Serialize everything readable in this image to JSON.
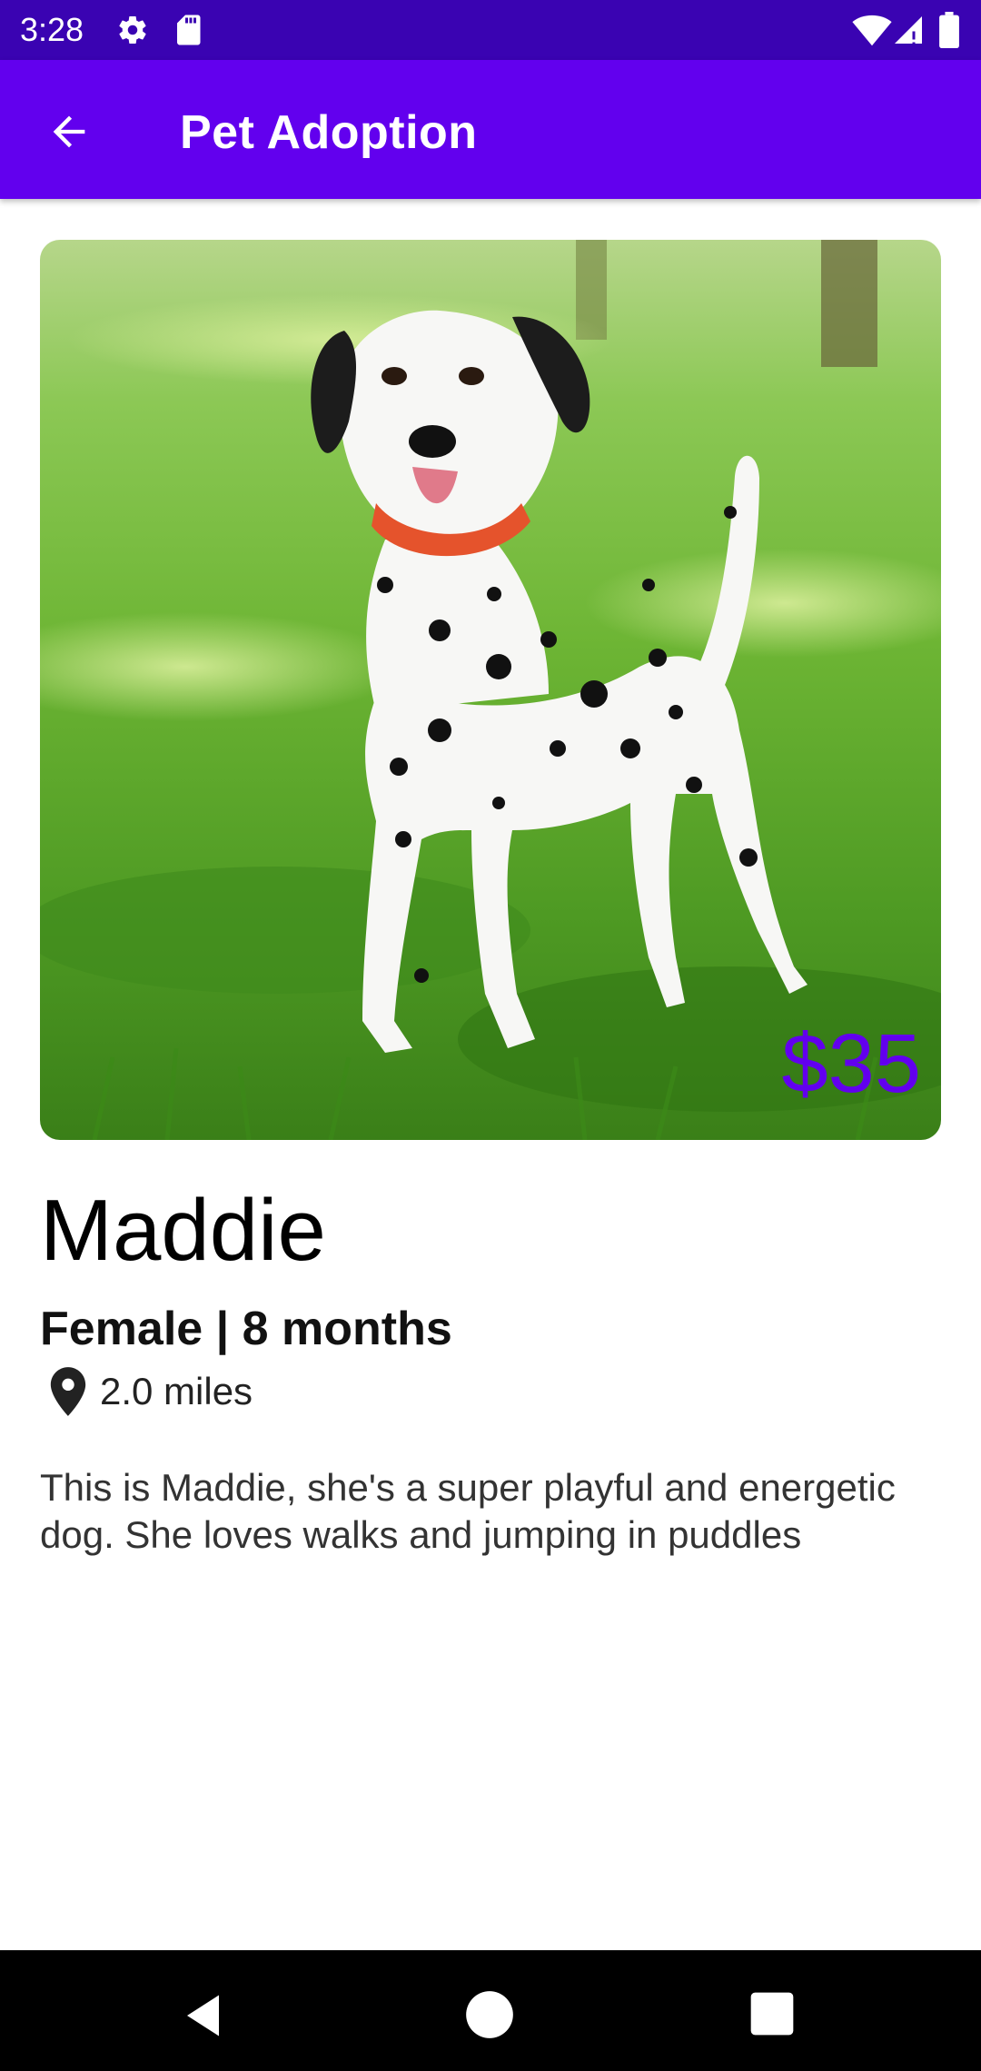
{
  "status_bar": {
    "time": "3:28",
    "icons": [
      "gear-icon",
      "sd-card-icon",
      "wifi-icon",
      "cell-signal-icon",
      "battery-icon"
    ]
  },
  "app_bar": {
    "title": "Pet Adoption",
    "back_icon": "arrow-back-icon",
    "background": "#6200ee",
    "status_background": "#3a03b2"
  },
  "pet": {
    "photo": "dalmatian-photo",
    "price": "$35",
    "name": "Maddie",
    "gender_age": "Female | 8 months",
    "distance": "2.0 miles",
    "description": "This is Maddie, she's a super playful and energetic dog. She loves walks and jumping in puddles"
  },
  "colors": {
    "accent": "#6200ee"
  },
  "nav_bar": {
    "icons": [
      "nav-back-icon",
      "nav-home-icon",
      "nav-recents-icon"
    ]
  }
}
